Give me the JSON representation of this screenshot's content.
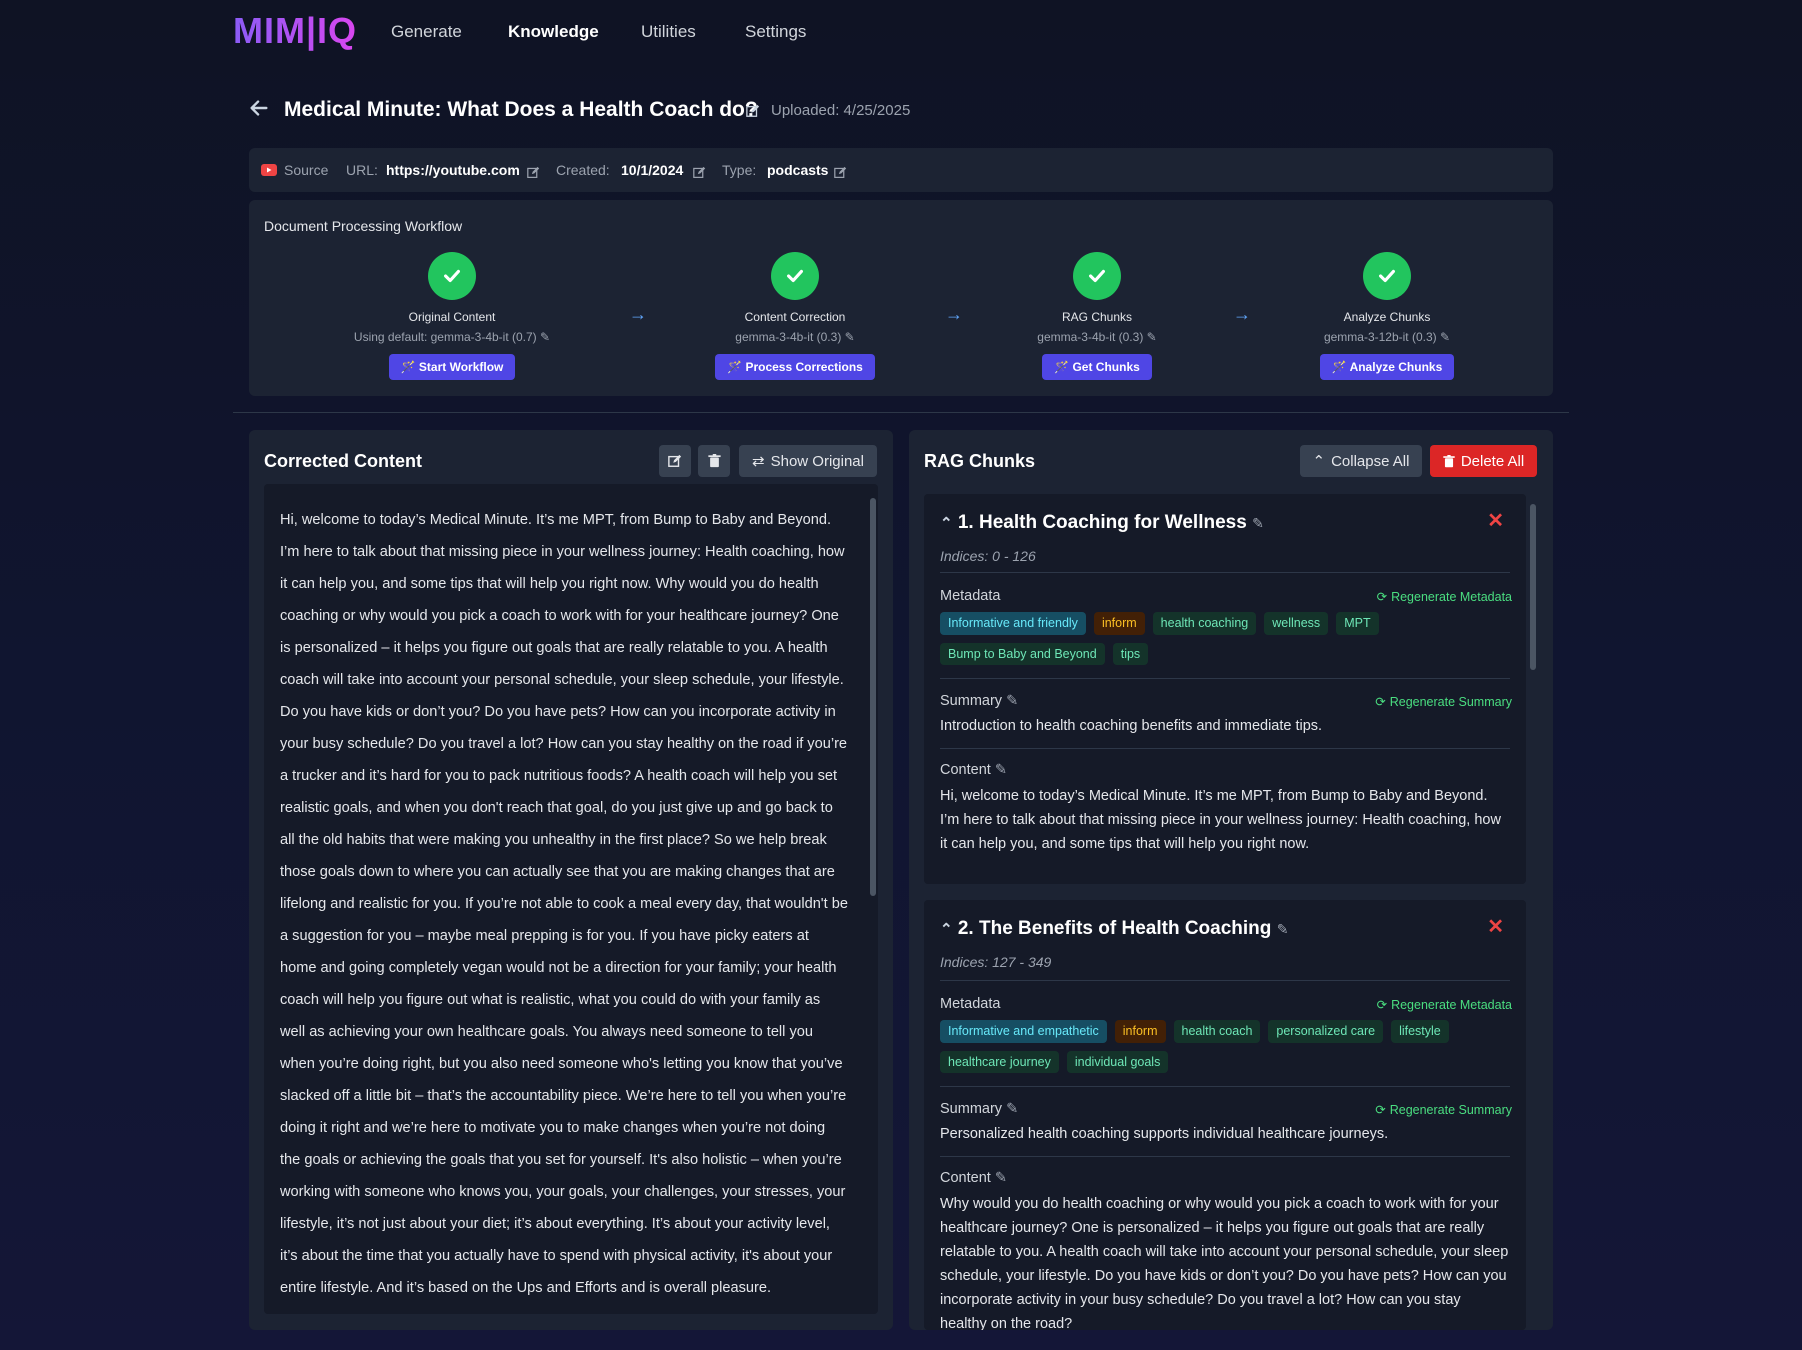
{
  "nav": {
    "logo": "MIM|IQ",
    "links": [
      "Generate",
      "Knowledge",
      "Utilities",
      "Settings"
    ],
    "active": "Knowledge"
  },
  "header": {
    "title": "Medical Minute: What Does a Health Coach do?",
    "uploaded": "Uploaded: 4/25/2025"
  },
  "source": {
    "source_label": "Source",
    "url_label": "URL:",
    "url_value": "https://youtube.com",
    "created_label": "Created:",
    "created_value": "10/1/2024",
    "type_label": "Type:",
    "type_value": "podcasts"
  },
  "workflow": {
    "title": "Document Processing Workflow",
    "steps": [
      {
        "title": "Original Content",
        "model": "Using default: gemma-3-4b-it (0.7)",
        "button": "Start Workflow"
      },
      {
        "title": "Content Correction",
        "model": "gemma-3-4b-it (0.3)",
        "button": "Process Corrections"
      },
      {
        "title": "RAG Chunks",
        "model": "gemma-3-4b-it (0.3)",
        "button": "Get Chunks"
      },
      {
        "title": "Analyze Chunks",
        "model": "gemma-3-12b-it (0.3)",
        "button": "Analyze Chunks"
      }
    ]
  },
  "corrected": {
    "title": "Corrected Content",
    "show_original": "Show Original",
    "text": "Hi, welcome to today’s Medical Minute. It’s me MPT, from Bump to Baby and Beyond. I’m here to talk about that missing piece in your wellness journey: Health coaching, how it can help you, and some tips that will help you right now. Why would you do health coaching or why would you pick a coach to work with for your healthcare journey? One is personalized – it helps you figure out goals that are really relatable to you. A health coach will take into account your personal schedule, your sleep schedule, your lifestyle. Do you have kids or don’t you? Do you have pets? How can you incorporate activity in your busy schedule? Do you travel a lot? How can you stay healthy on the road if you’re a trucker and it’s hard for you to pack nutritious foods? A health coach will help you set realistic goals, and when you don't reach that goal, do you just give up and go back to all the old habits that were making you unhealthy in the first place? So we help break those goals down to where you can actually see that you are making changes that are lifelong and realistic for you. If you’re not able to cook a meal every day, that wouldn't be a suggestion for you – maybe meal prepping is for you. If you have picky eaters at home and going completely vegan would not be a direction for your family; your health coach will help you figure out what is realistic, what you could do with your family as well as achieving your own healthcare goals. You always need someone to tell you when you’re doing right, but you also need someone who's letting you know that you’ve slacked off a little bit – that’s the accountability piece. We’re here to tell you when you’re doing it right and we’re here to motivate you to make changes when you’re not doing the goals or achieving the goals that you set for yourself. It's also holistic – when you’re working with someone who knows you, your goals, your challenges, your stresses, your lifestyle, it’s not just about your diet; it’s about everything. It’s about your activity level, it’s about the time that you actually have to spend with physical activity, it's about your entire lifestyle. And it’s based on the Ups and Efforts and is overall pleasure."
  },
  "rag": {
    "title": "RAG Chunks",
    "collapse_all": "Collapse All",
    "delete_all": "Delete All",
    "metadata_label": "Metadata",
    "summary_label": "Summary",
    "content_label": "Content",
    "regen_metadata": "Regenerate Metadata",
    "regen_summary": "Regenerate Summary",
    "chunks": [
      {
        "title": "1. Health Coaching for Wellness",
        "indices": "Indices: 0 - 126",
        "tags": [
          {
            "text": "Informative and friendly",
            "kind": "tone"
          },
          {
            "text": "inform",
            "kind": "intent"
          },
          {
            "text": "health coaching",
            "kind": "topic"
          },
          {
            "text": "wellness",
            "kind": "topic"
          },
          {
            "text": "MPT",
            "kind": "topic"
          },
          {
            "text": "Bump to Baby and Beyond",
            "kind": "topic"
          },
          {
            "text": "tips",
            "kind": "topic"
          }
        ],
        "summary": "Introduction to health coaching benefits and immediate tips.",
        "content": "Hi, welcome to today’s Medical Minute. It’s me MPT, from Bump to Baby and Beyond. I’m here to talk about that missing piece in your wellness journey: Health coaching, how it can help you, and some tips that will help you right now."
      },
      {
        "title": "2. The Benefits of Health Coaching",
        "indices": "Indices: 127 - 349",
        "tags": [
          {
            "text": "Informative and empathetic",
            "kind": "tone"
          },
          {
            "text": "inform",
            "kind": "intent"
          },
          {
            "text": "health coach",
            "kind": "topic"
          },
          {
            "text": "personalized care",
            "kind": "topic"
          },
          {
            "text": "lifestyle",
            "kind": "topic"
          },
          {
            "text": "healthcare journey",
            "kind": "topic"
          },
          {
            "text": "individual goals",
            "kind": "topic"
          }
        ],
        "summary": "Personalized health coaching supports individual healthcare journeys.",
        "content": "Why would you do health coaching or why would you pick a coach to work with for your healthcare journey? One is personalized – it helps you figure out goals that are really relatable to you. A health coach will take into account your personal schedule, your sleep schedule, your lifestyle. Do you have kids or don’t you? Do you have pets? How can you incorporate activity in your busy schedule? Do you travel a lot? How can you stay healthy on the road?"
      }
    ]
  }
}
